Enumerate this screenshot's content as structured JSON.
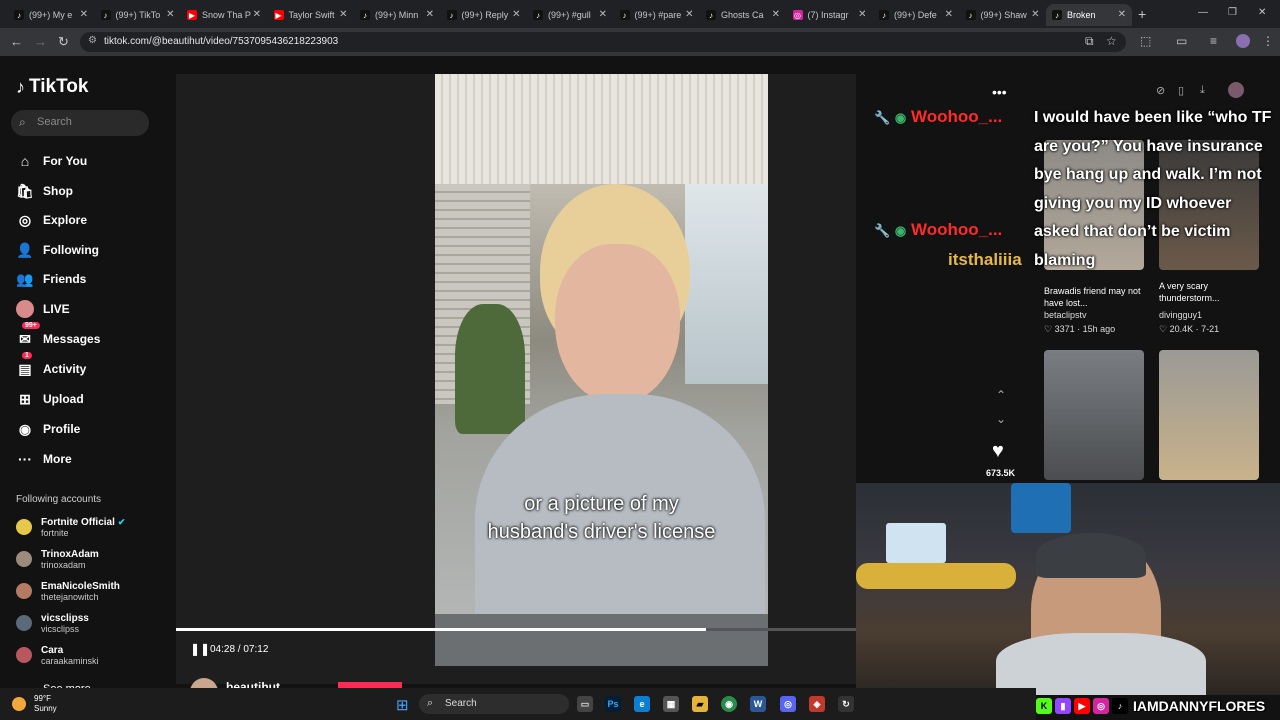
{
  "browser": {
    "tabs": [
      {
        "label": "(99+) My e",
        "icon": "tiktok-icon"
      },
      {
        "label": "(99+) TikTo",
        "icon": "tiktok-icon"
      },
      {
        "label": "Snow Tha P",
        "icon": "youtube-icon"
      },
      {
        "label": "Taylor Swift",
        "icon": "youtube-icon"
      },
      {
        "label": "(99+) Minn",
        "icon": "tiktok-icon"
      },
      {
        "label": "(99+) Reply",
        "icon": "tiktok-icon"
      },
      {
        "label": "(99+) #gull",
        "icon": "tiktok-icon"
      },
      {
        "label": "(99+) #pare",
        "icon": "tiktok-icon"
      },
      {
        "label": "Ghosts Ca",
        "icon": "tiktok-icon"
      },
      {
        "label": "(7) Instagr",
        "icon": "instagram-icon"
      },
      {
        "label": "(99+) Defe",
        "icon": "tiktok-icon"
      },
      {
        "label": "(99+) Shaw",
        "icon": "tiktok-icon"
      },
      {
        "label": "Broken",
        "icon": "tiktok-icon",
        "active": true
      }
    ],
    "url": "tiktok.com/@beautihut/video/7537095436218223903"
  },
  "sidebar": {
    "logo": "TikTok",
    "search_placeholder": "Search",
    "nav": [
      {
        "label": "For You",
        "icon": "home-icon",
        "glyph": "⌂"
      },
      {
        "label": "Shop",
        "icon": "shop-icon",
        "glyph": "🛍"
      },
      {
        "label": "Explore",
        "icon": "compass-icon",
        "glyph": "◎"
      },
      {
        "label": "Following",
        "icon": "following-icon",
        "glyph": "👤"
      },
      {
        "label": "Friends",
        "icon": "friends-icon",
        "glyph": "👥"
      },
      {
        "label": "LIVE",
        "icon": "live-icon",
        "glyph": "●"
      },
      {
        "label": "Messages",
        "icon": "messages-icon",
        "glyph": "✉",
        "badge": "99+"
      },
      {
        "label": "Activity",
        "icon": "activity-icon",
        "glyph": "▤",
        "badge": "1"
      },
      {
        "label": "Upload",
        "icon": "upload-icon",
        "glyph": "⊞"
      },
      {
        "label": "Profile",
        "icon": "profile-icon",
        "glyph": "◉"
      },
      {
        "label": "More",
        "icon": "more-icon",
        "glyph": "···"
      }
    ],
    "following_title": "Following accounts",
    "accounts": [
      {
        "name": "Fortnite Official",
        "user": "fortnite",
        "verified": true,
        "color": "#e6c84a"
      },
      {
        "name": "TrinoxAdam",
        "user": "trinoxadam",
        "color": "#9b8b7a"
      },
      {
        "name": "EmaNicoleSmith",
        "user": "thetejanowitch",
        "color": "#b57a64"
      },
      {
        "name": "vicsclipss",
        "user": "vicsclipss",
        "color": "#5a6a7a"
      },
      {
        "name": "Cara",
        "user": "caraakaminski",
        "color": "#b8585e"
      }
    ],
    "see_more": "See more"
  },
  "player": {
    "caption_line1": "or a picture of my",
    "caption_line2": "husband's driver's license",
    "time": "04:28 / 07:12",
    "progress": 0.78,
    "author": "beautihut",
    "likes": "673.5K"
  },
  "chat": [
    {
      "text": "Woohoo_...",
      "color": "#ff2a2a"
    },
    {
      "text": "Woohoo_...",
      "color": "#ff2a2a"
    },
    {
      "text": "itsthaliiia",
      "color": "#e6b84a"
    }
  ],
  "overlay_text": "I would have been like “who TF are you?” You have insurance bye hang up and walk. I’m not giving you my ID whoever asked that don’t be victim blaming",
  "suggestions": [
    {
      "caption": "Brawadis friend may not have lost...",
      "user": "betaclipstv",
      "stat": "3371 · 15h ago"
    },
    {
      "caption": "A very scary thunderstorm...",
      "user": "divingguy1",
      "stat": "20.4K · 7-21"
    }
  ],
  "stream": {
    "handle": "IAMDANNYFLORES"
  },
  "taskbar": {
    "temp": "99°F",
    "condition": "Sunny",
    "search": "Search"
  }
}
